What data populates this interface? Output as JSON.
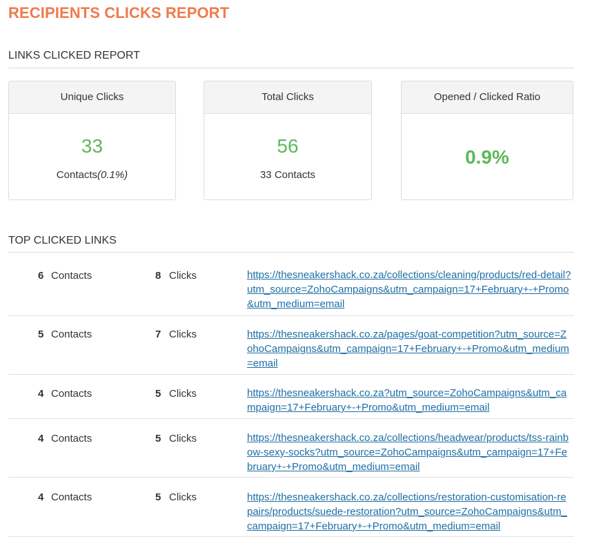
{
  "page": {
    "title": "RECIPIENTS CLICKS REPORT"
  },
  "links_report": {
    "heading": "LINKS CLICKED REPORT",
    "cards": [
      {
        "title": "Unique Clicks",
        "value": "33",
        "sub_text": "Contacts",
        "sub_italic": "(0.1%)"
      },
      {
        "title": "Total Clicks",
        "value": "56",
        "sub_text": "33 Contacts"
      },
      {
        "title": "Opened / Clicked Ratio",
        "value": "0.9%"
      }
    ]
  },
  "top_links": {
    "heading": "TOP CLICKED LINKS",
    "rows": [
      {
        "contacts": "6",
        "contacts_label": "Contacts",
        "clicks": "8",
        "clicks_label": "Clicks",
        "url": "https://thesneakershack.co.za/collections/cleaning/products/red-detail?utm_source=ZohoCampaigns&utm_campaign=17+February+-+Promo&utm_medium=email"
      },
      {
        "contacts": "5",
        "contacts_label": "Contacts",
        "clicks": "7",
        "clicks_label": "Clicks",
        "url": "https://thesneakershack.co.za/pages/goat-competition?utm_source=ZohoCampaigns&utm_campaign=17+February+-+Promo&utm_medium=email"
      },
      {
        "contacts": "4",
        "contacts_label": "Contacts",
        "clicks": "5",
        "clicks_label": "Clicks",
        "url": "https://thesneakershack.co.za?utm_source=ZohoCampaigns&utm_campaign=17+February+-+Promo&utm_medium=email"
      },
      {
        "contacts": "4",
        "contacts_label": "Contacts",
        "clicks": "5",
        "clicks_label": "Clicks",
        "url": "https://thesneakershack.co.za/collections/headwear/products/tss-rainbow-sexy-socks?utm_source=ZohoCampaigns&utm_campaign=17+February+-+Promo&utm_medium=email"
      },
      {
        "contacts": "4",
        "contacts_label": "Contacts",
        "clicks": "5",
        "clicks_label": "Clicks",
        "url": "https://thesneakershack.co.za/collections/restoration-customisation-repairs/products/suede-restoration?utm_source=ZohoCampaigns&utm_campaign=17+February+-+Promo&utm_medium=email"
      }
    ]
  }
}
